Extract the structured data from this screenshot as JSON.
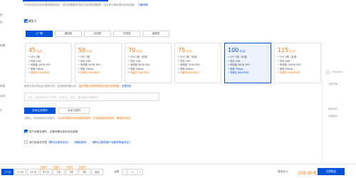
{
  "description": {
    "text": "平均标准包括系统通知基础服务，建议根据需求选择合适的配置套餐，包含即可满足基本使用场景。",
    "link": "了解详情"
  },
  "side_labels": [
    "型",
    "目",
    "配置",
    "带宽",
    "名称",
    "平",
    "",
    ""
  ],
  "burst_label": "爆发力",
  "tabs": [
    {
      "label": "入门型",
      "active": true
    },
    {
      "label": "通用型",
      "active": false
    },
    {
      "label": "存储型",
      "active": false
    },
    {
      "label": "专属型",
      "active": false
    },
    {
      "label": "旗舰型",
      "active": false
    }
  ],
  "cards": [
    {
      "price": "45",
      "unit": "元/月",
      "specs": [
        "CPU 2核",
        "内存 2GB",
        "系统盘 40GB SSD",
        "带宽 3Mbps",
        "流量包 200GB/月"
      ],
      "selected": false
    },
    {
      "price": "50",
      "unit": "元/月",
      "specs": [
        "CPU 2核",
        "内存 2GB",
        "系统盘 50GB SSD",
        "带宽 3Mbps",
        "流量包 300GB/月"
      ],
      "selected": false
    },
    {
      "price": "70",
      "unit": "元/月",
      "specs": [
        "CPU 2核（标准）",
        "内存 4GB",
        "系统盘 60GB SSD",
        "带宽 5Mbps",
        "流量包 500GB/月"
      ],
      "selected": false
    },
    {
      "price": "75",
      "unit": "元/月",
      "specs": [
        "CPU 2核（标准）",
        "内存 4GB",
        "系统盘 70GB SSD",
        "带宽 6Mbps",
        "流量包 600GB/月"
      ],
      "selected": false
    },
    {
      "price": "100",
      "unit": "元/月",
      "specs": [
        "CPU 2核（标准）",
        "内存 4GB",
        "系统盘 80GB SSD",
        "带宽 7Mbps",
        "流量包 800GB/月"
      ],
      "selected": true
    },
    {
      "price": "115",
      "unit": "元/月",
      "specs": [
        "CPU 2核（标准）",
        "内存 8GB",
        "系统盘 100GB SSD",
        "带宽 8Mbps",
        "流量包 1000GB/月"
      ],
      "selected": false
    }
  ],
  "right_panel": [
    "Renewal...",
    "云服务器...",
    "最新动态",
    "资源监控..."
  ],
  "hint": {
    "text": "配置实例必须包含内网和外网，系统按照规格计费。",
    "warn": "建议根据业务需求选择合适的实例规格。",
    "link": "查看详情"
  },
  "name_input": {
    "placeholder": "可选，长度不超过60个字符，支持中文、英文、数字及部分特殊符号"
  },
  "mode_buttons": [
    {
      "label": "自动生成密码",
      "active": true
    },
    {
      "label": "自定义密码",
      "active": false
    }
  ],
  "note": {
    "text": "创建后，系统将自动生成密码，",
    "warn": "请及时查看站内信获取登录密码，并妥善保管您的密码，确保账号安全。"
  },
  "options": {
    "auto_renew": "账户余额足够时，设备到期后按月自动续费",
    "agree_prefix": "我已阅读并同意",
    "agree_links": "《腾讯云服务协议》、《退款规则》、《腾讯云服务器产品服务等级协议》"
  },
  "bottom": {
    "durations": [
      {
        "label": "1个月",
        "active": true,
        "badge": ""
      },
      {
        "label": "2个月",
        "active": false,
        "badge": ""
      },
      {
        "label": "3个月",
        "active": false,
        "badge": ""
      },
      {
        "label": "6个月",
        "active": false,
        "badge": "9折"
      },
      {
        "label": "1年",
        "active": false,
        "badge": "8折"
      },
      {
        "label": "2年",
        "active": false,
        "badge": "7折"
      },
      {
        "label": "3年",
        "active": false,
        "badge": "6折"
      },
      {
        "label": "更多",
        "active": false,
        "badge": ""
      }
    ],
    "quantity_label": "台数",
    "quantity_value": "1",
    "minus": "−",
    "plus": "+",
    "fee_label": "费用合计",
    "fee_value": "100.00元",
    "buy_label": "立即购买"
  },
  "colors": {
    "accent": "#0052d9",
    "price": "#ff7200"
  }
}
